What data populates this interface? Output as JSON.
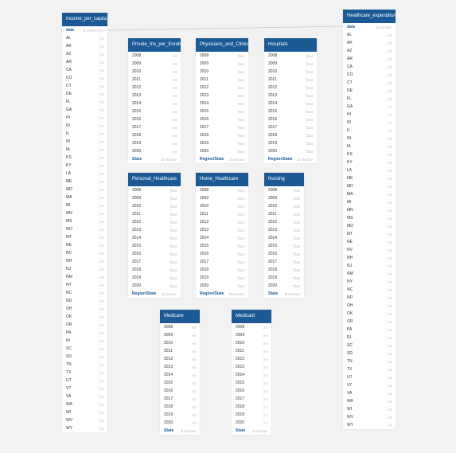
{
  "tables": [
    {
      "id": "income",
      "title": "Income_per_capita",
      "rows": [
        {
          "name": "date",
          "type": "VARCHAR",
          "key": true
        },
        {
          "name": "AL",
          "type": "int"
        },
        {
          "name": "AK",
          "type": "int"
        },
        {
          "name": "AZ",
          "type": "int"
        },
        {
          "name": "AR",
          "type": "int"
        },
        {
          "name": "CA",
          "type": "int"
        },
        {
          "name": "CO",
          "type": "int"
        },
        {
          "name": "CT",
          "type": "int"
        },
        {
          "name": "DE",
          "type": "int"
        },
        {
          "name": "FL",
          "type": "int"
        },
        {
          "name": "GA",
          "type": "int"
        },
        {
          "name": "HI",
          "type": "int"
        },
        {
          "name": "ID",
          "type": "int"
        },
        {
          "name": "IL",
          "type": "int"
        },
        {
          "name": "IN",
          "type": "int"
        },
        {
          "name": "IA",
          "type": "int"
        },
        {
          "name": "KS",
          "type": "int"
        },
        {
          "name": "KY",
          "type": "int"
        },
        {
          "name": "LA",
          "type": "int"
        },
        {
          "name": "ME",
          "type": "int"
        },
        {
          "name": "MD",
          "type": "int"
        },
        {
          "name": "MA",
          "type": "int"
        },
        {
          "name": "MI",
          "type": "int"
        },
        {
          "name": "MN",
          "type": "int"
        },
        {
          "name": "MS",
          "type": "int"
        },
        {
          "name": "MO",
          "type": "int"
        },
        {
          "name": "MT",
          "type": "int"
        },
        {
          "name": "NE",
          "type": "int"
        },
        {
          "name": "NV",
          "type": "int"
        },
        {
          "name": "NH",
          "type": "int"
        },
        {
          "name": "NJ",
          "type": "int"
        },
        {
          "name": "NM",
          "type": "int"
        },
        {
          "name": "NY",
          "type": "int"
        },
        {
          "name": "NC",
          "type": "int"
        },
        {
          "name": "ND",
          "type": "int"
        },
        {
          "name": "OH",
          "type": "int"
        },
        {
          "name": "OK",
          "type": "int"
        },
        {
          "name": "OR",
          "type": "int"
        },
        {
          "name": "PA",
          "type": "int"
        },
        {
          "name": "RI",
          "type": "int"
        },
        {
          "name": "SC",
          "type": "int"
        },
        {
          "name": "SD",
          "type": "int"
        },
        {
          "name": "TN",
          "type": "int"
        },
        {
          "name": "TX",
          "type": "int"
        },
        {
          "name": "UT",
          "type": "int"
        },
        {
          "name": "VT",
          "type": "int"
        },
        {
          "name": "VA",
          "type": "int"
        },
        {
          "name": "WA",
          "type": "int"
        },
        {
          "name": "WI",
          "type": "int"
        },
        {
          "name": "WV",
          "type": "int"
        },
        {
          "name": "WY",
          "type": "int"
        }
      ]
    },
    {
      "id": "private",
      "title": "Private_Ins_per_Enrollee",
      "rows": [
        {
          "name": "2008",
          "type": "int"
        },
        {
          "name": "2009",
          "type": "int"
        },
        {
          "name": "2010",
          "type": "int"
        },
        {
          "name": "2011",
          "type": "int"
        },
        {
          "name": "2012",
          "type": "int"
        },
        {
          "name": "2013",
          "type": "int"
        },
        {
          "name": "2014",
          "type": "int"
        },
        {
          "name": "2015",
          "type": "int"
        },
        {
          "name": "2016",
          "type": "int"
        },
        {
          "name": "2017",
          "type": "int"
        },
        {
          "name": "2018",
          "type": "int"
        },
        {
          "name": "2019",
          "type": "int"
        },
        {
          "name": "2020",
          "type": "int"
        },
        {
          "name": "State",
          "type": "varchar",
          "key": true
        }
      ]
    },
    {
      "id": "physicians",
      "title": "Physicians_and_Clinics",
      "rows": [
        {
          "name": "2008",
          "type": "float"
        },
        {
          "name": "2009",
          "type": "float"
        },
        {
          "name": "2010",
          "type": "float"
        },
        {
          "name": "2011",
          "type": "float"
        },
        {
          "name": "2012",
          "type": "float"
        },
        {
          "name": "2013",
          "type": "float"
        },
        {
          "name": "2014",
          "type": "float"
        },
        {
          "name": "2015",
          "type": "float"
        },
        {
          "name": "2016",
          "type": "float"
        },
        {
          "name": "2017",
          "type": "float"
        },
        {
          "name": "2018",
          "type": "float"
        },
        {
          "name": "2019",
          "type": "float"
        },
        {
          "name": "2020",
          "type": "float"
        },
        {
          "name": "Region/State",
          "type": "varchar",
          "key": true
        }
      ]
    },
    {
      "id": "hospitals",
      "title": "Hospitals",
      "rows": [
        {
          "name": "2008",
          "type": "float"
        },
        {
          "name": "2009",
          "type": "float"
        },
        {
          "name": "2010",
          "type": "float"
        },
        {
          "name": "2011",
          "type": "float"
        },
        {
          "name": "2012",
          "type": "float"
        },
        {
          "name": "2013",
          "type": "float"
        },
        {
          "name": "2014",
          "type": "float"
        },
        {
          "name": "2015",
          "type": "float"
        },
        {
          "name": "2016",
          "type": "float"
        },
        {
          "name": "2017",
          "type": "float"
        },
        {
          "name": "2018",
          "type": "float"
        },
        {
          "name": "2019",
          "type": "float"
        },
        {
          "name": "2020",
          "type": "float"
        },
        {
          "name": "Region/State",
          "type": "varchar",
          "key": true
        }
      ]
    },
    {
      "id": "healthexp",
      "title": "Healthcare_expenditures",
      "rows": [
        {
          "name": "date",
          "type": "varchar",
          "key": true
        },
        {
          "name": "AL",
          "type": "int"
        },
        {
          "name": "AK",
          "type": "int"
        },
        {
          "name": "AZ",
          "type": "int"
        },
        {
          "name": "AR",
          "type": "int"
        },
        {
          "name": "CA",
          "type": "int"
        },
        {
          "name": "CO",
          "type": "int"
        },
        {
          "name": "CT",
          "type": "int"
        },
        {
          "name": "DE",
          "type": "int"
        },
        {
          "name": "FL",
          "type": "int"
        },
        {
          "name": "GA",
          "type": "int"
        },
        {
          "name": "HI",
          "type": "int"
        },
        {
          "name": "ID",
          "type": "int"
        },
        {
          "name": "IL",
          "type": "int"
        },
        {
          "name": "IN",
          "type": "int"
        },
        {
          "name": "IA",
          "type": "int"
        },
        {
          "name": "KS",
          "type": "int"
        },
        {
          "name": "KY",
          "type": "int"
        },
        {
          "name": "LA",
          "type": "int"
        },
        {
          "name": "ME",
          "type": "int"
        },
        {
          "name": "MD",
          "type": "int"
        },
        {
          "name": "MA",
          "type": "int"
        },
        {
          "name": "MI",
          "type": "int"
        },
        {
          "name": "MN",
          "type": "int"
        },
        {
          "name": "MS",
          "type": "int"
        },
        {
          "name": "MO",
          "type": "int"
        },
        {
          "name": "MT",
          "type": "int"
        },
        {
          "name": "NE",
          "type": "int"
        },
        {
          "name": "NV",
          "type": "int"
        },
        {
          "name": "NH",
          "type": "int"
        },
        {
          "name": "NJ",
          "type": "int"
        },
        {
          "name": "NM",
          "type": "int"
        },
        {
          "name": "NY",
          "type": "int"
        },
        {
          "name": "NC",
          "type": "int"
        },
        {
          "name": "ND",
          "type": "int"
        },
        {
          "name": "OH",
          "type": "int"
        },
        {
          "name": "OK",
          "type": "int"
        },
        {
          "name": "OR",
          "type": "int"
        },
        {
          "name": "PA",
          "type": "int"
        },
        {
          "name": "RI",
          "type": "int"
        },
        {
          "name": "SC",
          "type": "int"
        },
        {
          "name": "SD",
          "type": "int"
        },
        {
          "name": "TN",
          "type": "int"
        },
        {
          "name": "TX",
          "type": "int"
        },
        {
          "name": "UT",
          "type": "int"
        },
        {
          "name": "VT",
          "type": "int"
        },
        {
          "name": "VA",
          "type": "int"
        },
        {
          "name": "WA",
          "type": "int"
        },
        {
          "name": "WI",
          "type": "int"
        },
        {
          "name": "WV",
          "type": "int"
        },
        {
          "name": "WY",
          "type": "int"
        }
      ]
    },
    {
      "id": "personal",
      "title": "Personal_Healthcare",
      "rows": [
        {
          "name": "2008",
          "type": "float"
        },
        {
          "name": "2009",
          "type": "float"
        },
        {
          "name": "2010",
          "type": "float"
        },
        {
          "name": "2011",
          "type": "float"
        },
        {
          "name": "2012",
          "type": "float"
        },
        {
          "name": "2013",
          "type": "float"
        },
        {
          "name": "2014",
          "type": "float"
        },
        {
          "name": "2015",
          "type": "float"
        },
        {
          "name": "2016",
          "type": "float"
        },
        {
          "name": "2017",
          "type": "float"
        },
        {
          "name": "2018",
          "type": "float"
        },
        {
          "name": "2019",
          "type": "float"
        },
        {
          "name": "2020",
          "type": "float"
        },
        {
          "name": "Region/State",
          "type": "varchar",
          "key": true
        }
      ]
    },
    {
      "id": "home",
      "title": "Home_Healthcare",
      "rows": [
        {
          "name": "2008",
          "type": "float"
        },
        {
          "name": "2009",
          "type": "float"
        },
        {
          "name": "2010",
          "type": "float"
        },
        {
          "name": "2011",
          "type": "float"
        },
        {
          "name": "2012",
          "type": "float"
        },
        {
          "name": "2013",
          "type": "float"
        },
        {
          "name": "2014",
          "type": "float"
        },
        {
          "name": "2015",
          "type": "float"
        },
        {
          "name": "2016",
          "type": "float"
        },
        {
          "name": "2017",
          "type": "float"
        },
        {
          "name": "2018",
          "type": "float"
        },
        {
          "name": "2019",
          "type": "float"
        },
        {
          "name": "2020",
          "type": "float"
        },
        {
          "name": "Region/State",
          "type": "varchar",
          "key": true
        }
      ]
    },
    {
      "id": "nursing",
      "title": "Nursing",
      "rows": [
        {
          "name": "2008",
          "type": "float"
        },
        {
          "name": "2009",
          "type": "float"
        },
        {
          "name": "2010",
          "type": "float"
        },
        {
          "name": "2011",
          "type": "float"
        },
        {
          "name": "2012",
          "type": "float"
        },
        {
          "name": "2013",
          "type": "float"
        },
        {
          "name": "2014",
          "type": "float"
        },
        {
          "name": "2015",
          "type": "float"
        },
        {
          "name": "2016",
          "type": "float"
        },
        {
          "name": "2017",
          "type": "float"
        },
        {
          "name": "2018",
          "type": "float"
        },
        {
          "name": "2019",
          "type": "float"
        },
        {
          "name": "2020",
          "type": "float"
        },
        {
          "name": "State",
          "type": "varchar",
          "key": true
        }
      ]
    },
    {
      "id": "medicare",
      "title": "Medicare",
      "rows": [
        {
          "name": "2008",
          "type": "int"
        },
        {
          "name": "2009",
          "type": "int"
        },
        {
          "name": "2010",
          "type": "int"
        },
        {
          "name": "2011",
          "type": "int"
        },
        {
          "name": "2012",
          "type": "int"
        },
        {
          "name": "2013",
          "type": "int"
        },
        {
          "name": "2014",
          "type": "int"
        },
        {
          "name": "2015",
          "type": "int"
        },
        {
          "name": "2016",
          "type": "int"
        },
        {
          "name": "2017",
          "type": "int"
        },
        {
          "name": "2018",
          "type": "int"
        },
        {
          "name": "2019",
          "type": "int"
        },
        {
          "name": "2020",
          "type": "int"
        },
        {
          "name": "State",
          "type": "varchar",
          "key": true
        }
      ]
    },
    {
      "id": "medicaid",
      "title": "Medicaid",
      "rows": [
        {
          "name": "2008",
          "type": "int"
        },
        {
          "name": "2009",
          "type": "int"
        },
        {
          "name": "2010",
          "type": "int"
        },
        {
          "name": "2011",
          "type": "int"
        },
        {
          "name": "2012",
          "type": "int"
        },
        {
          "name": "2013",
          "type": "int"
        },
        {
          "name": "2014",
          "type": "int"
        },
        {
          "name": "2015",
          "type": "int"
        },
        {
          "name": "2016",
          "type": "int"
        },
        {
          "name": "2017",
          "type": "int"
        },
        {
          "name": "2018",
          "type": "int"
        },
        {
          "name": "2019",
          "type": "int"
        },
        {
          "name": "2020",
          "type": "int"
        },
        {
          "name": "State",
          "type": "varchar",
          "key": true
        }
      ]
    }
  ],
  "relationships": [
    {
      "from": "income.date",
      "to": "healthexp.date"
    }
  ],
  "colors": {
    "header": "#1c5a96",
    "background": "#f2f2f2"
  }
}
